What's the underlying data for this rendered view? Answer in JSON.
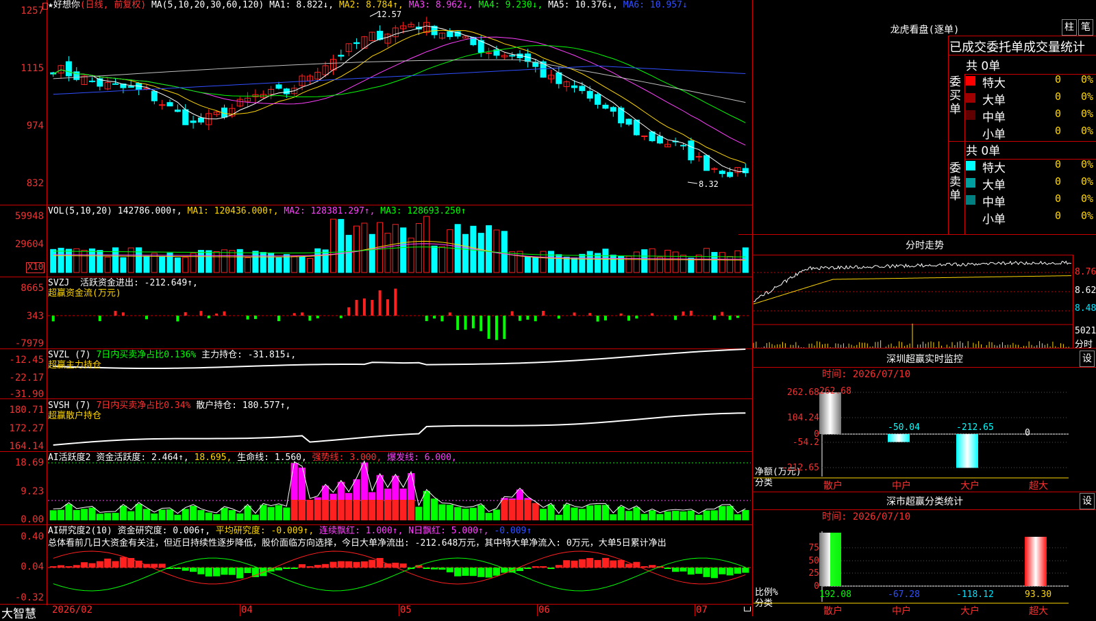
{
  "app": {
    "name": "大智慧"
  },
  "kline": {
    "title_star": "★",
    "stock_name": "好想你",
    "mode": "(日线, 前复权)",
    "ma_list": "MA(5,10,20,30,60,120)",
    "ma1": "MA1: 8.822↓,",
    "ma2": "MA2: 8.784↑,",
    "ma3": "MA3: 8.962↓,",
    "ma4": "MA4: 9.230↓,",
    "ma5": "MA5: 10.376↓,",
    "ma6": "MA6: 10.957↓",
    "axis": [
      "1257",
      "1115",
      "974",
      "832"
    ],
    "high_label": "12.57",
    "low_label": "8.32"
  },
  "vol": {
    "title": "VOL(5,10,20)",
    "val": "142786.000↑,",
    "ma1": "MA1: 120436.000↑,",
    "ma2": "MA2: 128381.297↑,",
    "ma3": "MA3: 128693.250↑",
    "axis": [
      "59948",
      "29604"
    ],
    "unit": "X10"
  },
  "svzj": {
    "title": "SVZJ",
    "line": "活跃资金进出: -212.649↑,",
    "sub": "超赢资金流(万元)",
    "axis": [
      "8665",
      "343",
      "-7979"
    ]
  },
  "svzl": {
    "title": "SVZL (7)",
    "line1": "7日内买卖净占比0.136%",
    "line2": "主力持仓: -31.815↓,",
    "sub": "超赢主力持仓",
    "axis": [
      "-12.45",
      "-22.17",
      "-31.90"
    ]
  },
  "svsh": {
    "title": "SVSH (7)",
    "line1": "7日内买卖净占比0.34%",
    "line2": "散户持仓: 180.577↑,",
    "sub": "超赢散户持仓",
    "axis": [
      "180.71",
      "172.27",
      "164.14"
    ]
  },
  "ai1": {
    "title": "AI活跃度2",
    "a": "资金活跃度: 2.464↑,",
    "b": "18.695,",
    "c": "生命线: 1.560,",
    "d": "强势线: 3.000,",
    "e": "爆发线: 6.000,",
    "axis": [
      "18.69",
      "9.23",
      "0.00"
    ]
  },
  "ai2": {
    "title": "AI研究度2(10)",
    "a": "资金研究度: 0.006↑,",
    "b": "平均研究度: -0.009↑,",
    "c": "连续飘红: 1.000↑,",
    "d": "N日飘红: 5.000↑,",
    "e": "-0.009↑",
    "summary": "总体看前几日大资金有关注，但近日持续性逐步降低，股价面临方向选择，今日大单净流出: -212.648万元，其中特大单净流入: 0万元，大单5日累计净出",
    "axis": [
      "0.40",
      "0.04",
      "-0.32"
    ]
  },
  "dates": [
    "2026/02",
    "04",
    "05",
    "06",
    "07"
  ],
  "lhb": {
    "title": "龙虎看盘(逐单)",
    "btn1": "柱",
    "btn2": "笔",
    "header": "已成交委托单成交量统计",
    "buy": {
      "label": "委买单",
      "total": "共 0单",
      "rows": [
        {
          "name": "特大",
          "count": "0",
          "pct": "0%",
          "color": "#ff0000"
        },
        {
          "name": "大单",
          "count": "0",
          "pct": "0%",
          "color": "#a00000"
        },
        {
          "name": "中单",
          "count": "0",
          "pct": "0%",
          "color": "#600000"
        },
        {
          "name": "小单",
          "count": "0",
          "pct": "0%",
          "color": ""
        }
      ]
    },
    "sell": {
      "label": "委卖单",
      "total": "共 0单",
      "rows": [
        {
          "name": "特大",
          "count": "0",
          "pct": "0%",
          "color": "#00ffff"
        },
        {
          "name": "大单",
          "count": "0",
          "pct": "0%",
          "color": "#00a0a0"
        },
        {
          "name": "中单",
          "count": "0",
          "pct": "0%",
          "color": "#008080"
        },
        {
          "name": "小单",
          "count": "0",
          "pct": "0%",
          "color": ""
        }
      ]
    }
  },
  "fenshi": {
    "title": "分时走势",
    "axis": [
      "8.76",
      "8.62",
      "8.48"
    ],
    "vol_label": "5021",
    "vol_unit": "分时"
  },
  "sz_monitor": {
    "title": "深圳超赢实时监控",
    "btn": "设",
    "time": "时间: 2026/07/10",
    "axis": [
      "262.68",
      "104.24",
      "0",
      "-54.2",
      "-212.65"
    ],
    "ylabel1": "净额(万元)",
    "ylabel2": "分类",
    "bars": [
      {
        "cat": "散户",
        "value": 262.68,
        "label": "262.68"
      },
      {
        "cat": "中户",
        "value": -50.04,
        "label": "-50.04"
      },
      {
        "cat": "大户",
        "value": -212.65,
        "label": "-212.65"
      },
      {
        "cat": "超大",
        "value": 0,
        "label": "0"
      }
    ]
  },
  "sz_stat": {
    "title": "深市超赢分类统计",
    "btn": "设",
    "time": "时间: 2026/07/10",
    "axis": [
      "75",
      "50",
      "25",
      "0"
    ],
    "ylabel1": "比例%",
    "ylabel2": "分类",
    "bars": [
      {
        "cat": "散户",
        "value": 192.08,
        "label": "192.08"
      },
      {
        "cat": "中户",
        "value": -67.28,
        "label": "-67.28"
      },
      {
        "cat": "大户",
        "value": -118.12,
        "label": "-118.12"
      },
      {
        "cat": "超大",
        "value": 93.3,
        "label": "93.30"
      }
    ]
  },
  "colors": {
    "up": "#ff2020",
    "down": "#00ffff",
    "grid": "#c00000",
    "ma1": "#ffffff",
    "ma2": "#ffd700",
    "ma3": "#ff40ff",
    "ma4": "#00ff00",
    "ma5": "#c0c0c0",
    "ma6": "#3050ff"
  }
}
